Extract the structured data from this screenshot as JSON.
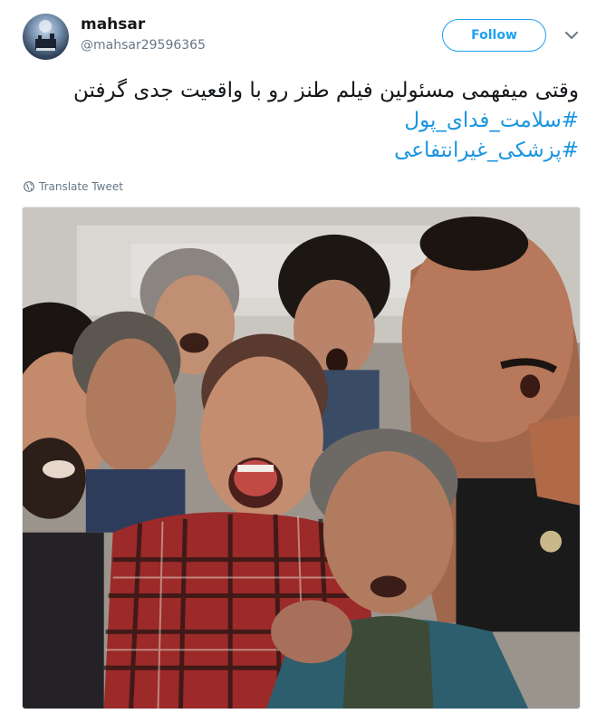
{
  "user": {
    "display_name": "mahsar",
    "screen_name": "@mahsar29596365"
  },
  "actions": {
    "follow_label": "Follow"
  },
  "tweet": {
    "line1": "وقتی میفهمی مسئولین فیلم طنز رو با واقعیت جدی گرفتن",
    "hashtag1": "#سلامت_فدای_پول",
    "hashtag2": "#پزشکی_غیرانتفاعی"
  },
  "translate_label": "Translate Tweet",
  "colors": {
    "accent": "#1da1f2",
    "hashtag": "#1b95e0",
    "muted": "#657786"
  },
  "icons": {
    "caret": "chevron-down-icon",
    "translate": "globe-icon"
  }
}
